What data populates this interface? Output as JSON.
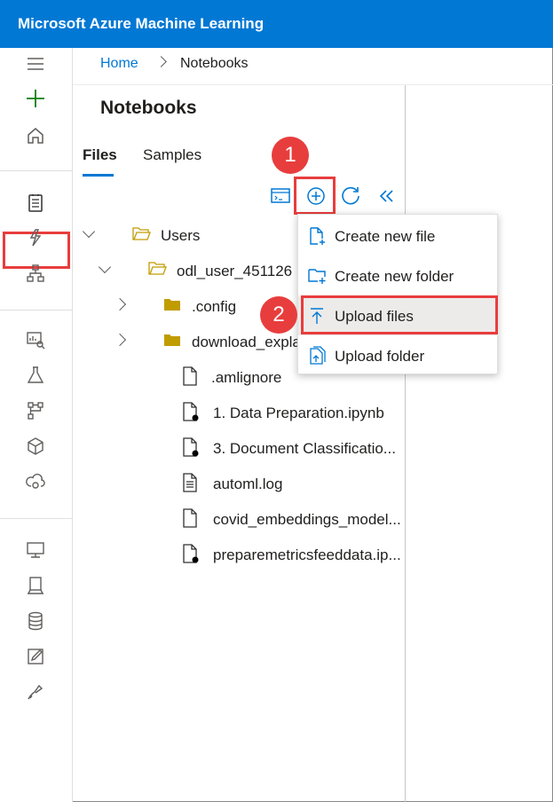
{
  "app": {
    "title": "Microsoft Azure Machine Learning"
  },
  "breadcrumb": {
    "home": "Home",
    "current": "Notebooks"
  },
  "page": {
    "title": "Notebooks"
  },
  "tabs": {
    "files": "Files",
    "samples": "Samples"
  },
  "callouts": {
    "one": "1",
    "two": "2"
  },
  "tree": {
    "items": [
      {
        "label": "Users"
      },
      {
        "label": "odl_user_451126"
      },
      {
        "label": ".config"
      },
      {
        "label": "download_expla"
      },
      {
        "label": ".amlignore"
      },
      {
        "label": "1. Data Preparation.ipynb"
      },
      {
        "label": "3. Document Classificatio..."
      },
      {
        "label": "automl.log"
      },
      {
        "label": "covid_embeddings_model..."
      },
      {
        "label": "preparemetricsfeeddata.ip..."
      }
    ]
  },
  "menu": {
    "items": [
      {
        "label": "Create new file"
      },
      {
        "label": "Create new folder"
      },
      {
        "label": "Upload files"
      },
      {
        "label": "Upload folder"
      }
    ]
  },
  "colors": {
    "accent": "#0078d4",
    "callout": "#e83d3d",
    "folder": "#c19c00",
    "success": "#107c10"
  }
}
